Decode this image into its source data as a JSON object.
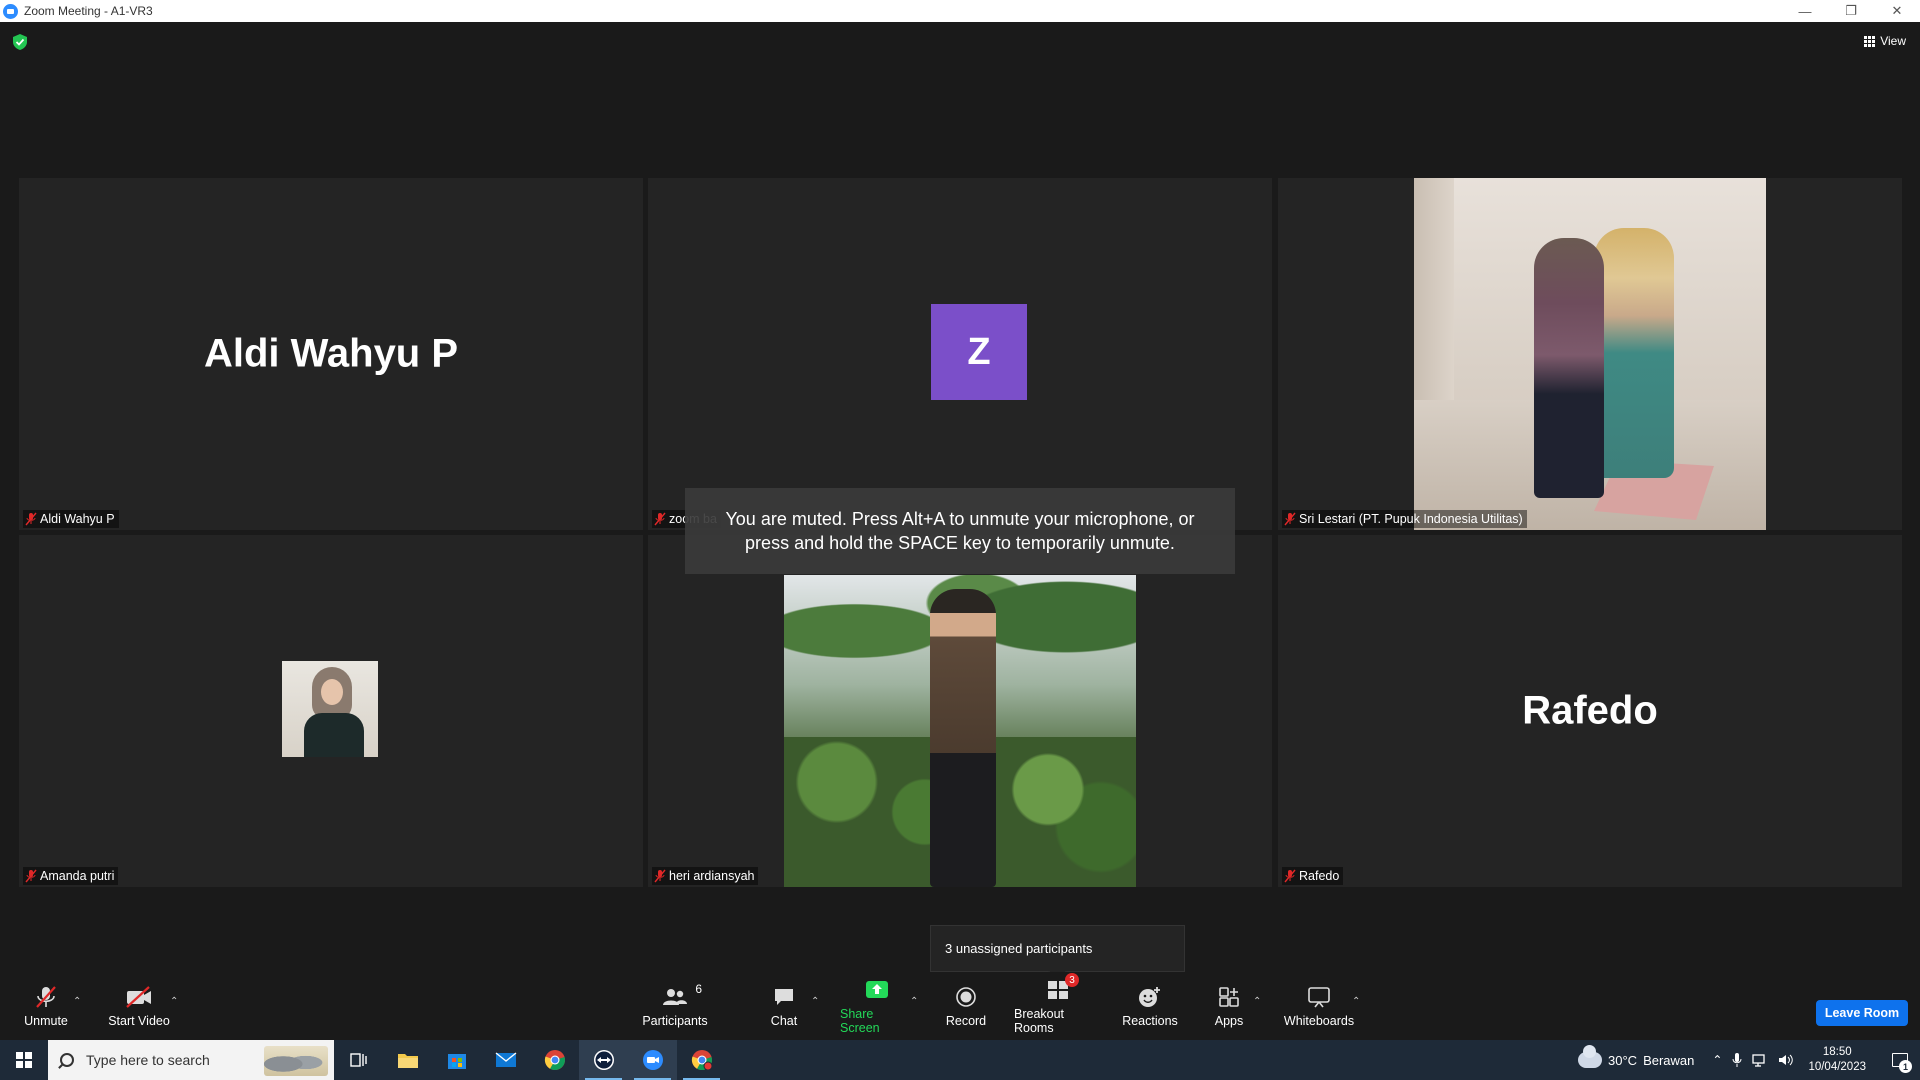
{
  "window": {
    "title": "Zoom Meeting - A1-VR3",
    "controls": [
      "minimize",
      "restore",
      "close"
    ]
  },
  "meeting": {
    "view_label": "View",
    "tiles": [
      {
        "id": "aldi",
        "display_name": "Aldi Wahyu P",
        "nameplate": "Aldi Wahyu P",
        "mic_muted": true,
        "video": "off-name"
      },
      {
        "id": "zoom",
        "avatar_letter": "Z",
        "avatar_color": "#7b4fc9",
        "nameplate": "zoom ba",
        "mic_muted": true,
        "video": "off-avatar"
      },
      {
        "id": "sri",
        "nameplate": "Sri Lestari (PT. Pupuk Indonesia Utilitas)",
        "mic_muted": true,
        "video": "on"
      },
      {
        "id": "amanda",
        "nameplate": "Amanda putri",
        "mic_muted": true,
        "video": "off-photo"
      },
      {
        "id": "heri",
        "nameplate": "heri ardiansyah",
        "mic_muted": true,
        "video": "on"
      },
      {
        "id": "rafedo",
        "display_name": "Rafedo",
        "nameplate": "Rafedo",
        "mic_muted": true,
        "video": "off-name"
      }
    ],
    "muted_toast": {
      "line1": "You are muted. Press Alt+A to unmute your microphone, or",
      "line2": "press and hold the SPACE key to temporarily unmute."
    },
    "unassigned_tooltip": "3 unassigned participants"
  },
  "toolbar": {
    "unmute": "Unmute",
    "start_video": "Start Video",
    "participants": "Participants",
    "participants_count": "6",
    "chat": "Chat",
    "share_screen": "Share Screen",
    "record": "Record",
    "breakout_rooms": "Breakout Rooms",
    "breakout_badge": "3",
    "reactions": "Reactions",
    "apps": "Apps",
    "whiteboards": "Whiteboards",
    "leave_room": "Leave Room",
    "colors": {
      "share_green": "#23d959",
      "leave_blue": "#0e72ed",
      "badge_red": "#e02828"
    }
  },
  "taskbar": {
    "search_placeholder": "Type here to search",
    "apps": [
      "task-view",
      "file-explorer",
      "microsoft-store",
      "mail",
      "chrome",
      "teamviewer",
      "zoom",
      "chrome-alt"
    ],
    "weather": {
      "temp": "30°C",
      "condition": "Berawan"
    },
    "time": "18:50",
    "date": "10/04/2023",
    "notification_count": "1"
  }
}
